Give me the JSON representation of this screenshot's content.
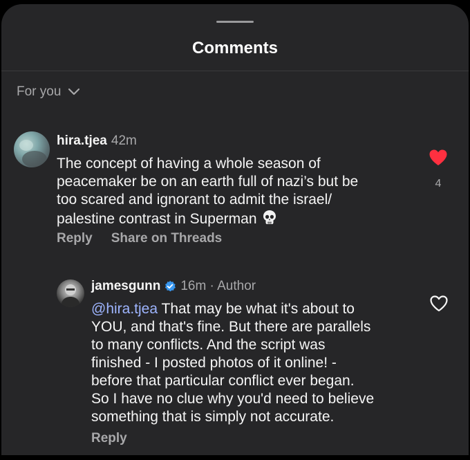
{
  "header": {
    "title": "Comments"
  },
  "filter": {
    "label": "For you"
  },
  "comments": [
    {
      "username": "hira.tjea",
      "time": "42m",
      "lines": [
        "The concept of having a whole season of",
        "peacemaker be on an earth full of nazi’s but be",
        "too scared and ignorant to admit the israel/",
        "palestine contrast in Superman"
      ],
      "emoji": "skull-emoji",
      "liked": true,
      "like_count": "4",
      "like_color": "#ff3040",
      "actions": {
        "reply": "Reply",
        "share": "Share on Threads"
      }
    },
    {
      "username": "jamesgunn",
      "verified": true,
      "meta": "16m · Author",
      "mention": "@hira.tjea",
      "first_line_rest": " That may be what it's about to",
      "lines": [
        "YOU, and that's fine. But there are parallels",
        "to many conflicts. And the script was",
        "finished - I posted photos of it online! -",
        "before that particular conflict ever began.",
        "So I have no clue why you'd need to believe",
        "something that is simply not accurate."
      ],
      "liked": false,
      "actions": {
        "reply": "Reply"
      }
    }
  ],
  "colors": {
    "sheet_background": "#262628",
    "mention": "#9eb5ff",
    "verified_badge": "#3897f0",
    "muted_text": "#a8a8aa"
  }
}
